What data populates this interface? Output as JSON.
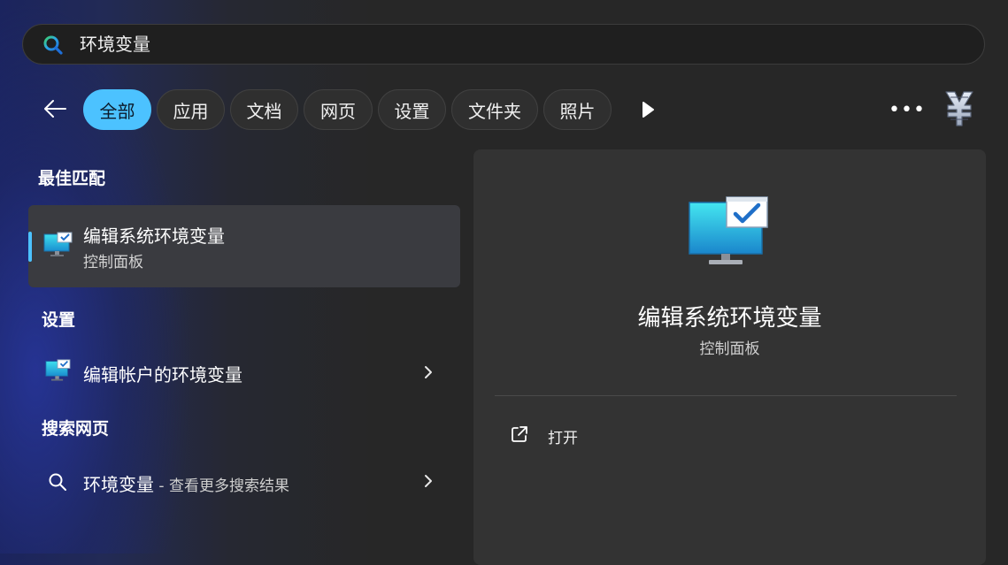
{
  "search": {
    "query": "环境变量"
  },
  "filters": {
    "tabs": [
      {
        "label": "全部"
      },
      {
        "label": "应用"
      },
      {
        "label": "文档"
      },
      {
        "label": "网页"
      },
      {
        "label": "设置"
      },
      {
        "label": "文件夹"
      },
      {
        "label": "照片"
      }
    ],
    "more_label": "•••"
  },
  "best_match": {
    "heading": "最佳匹配",
    "title": "编辑系统环境变量",
    "subtitle": "控制面板"
  },
  "settings": {
    "heading": "设置",
    "item_label": "编辑帐户的环境变量"
  },
  "web": {
    "heading": "搜索网页",
    "query": "环境变量",
    "suffix": " - 查看更多搜索结果"
  },
  "detail": {
    "title": "编辑系统环境变量",
    "subtitle": "控制面板",
    "open_label": "打开"
  },
  "colors": {
    "accent": "#4cc2ff",
    "panel": "#333333",
    "card": "#3a3b40"
  }
}
